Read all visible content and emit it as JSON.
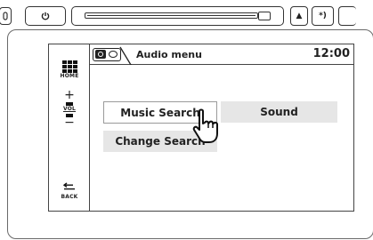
{
  "header": {
    "title": "Audio menu",
    "clock": "12:00"
  },
  "side": {
    "home_label": "HOME",
    "vol_label": "VOL",
    "vol_plus": "+",
    "vol_minus": "−",
    "back_label": "BACK"
  },
  "menu": {
    "music_search": "Music Search",
    "sound": "Sound",
    "change_search": "Change Search"
  },
  "hardware": {
    "eject_glyph": "▲",
    "tuner_glyph": "*)"
  },
  "icons": [
    "power-icon",
    "eject-icon",
    "tuner-icon",
    "home-grid-icon",
    "back-arrow-icon",
    "disc-source-icon",
    "pointer-hand-icon"
  ]
}
